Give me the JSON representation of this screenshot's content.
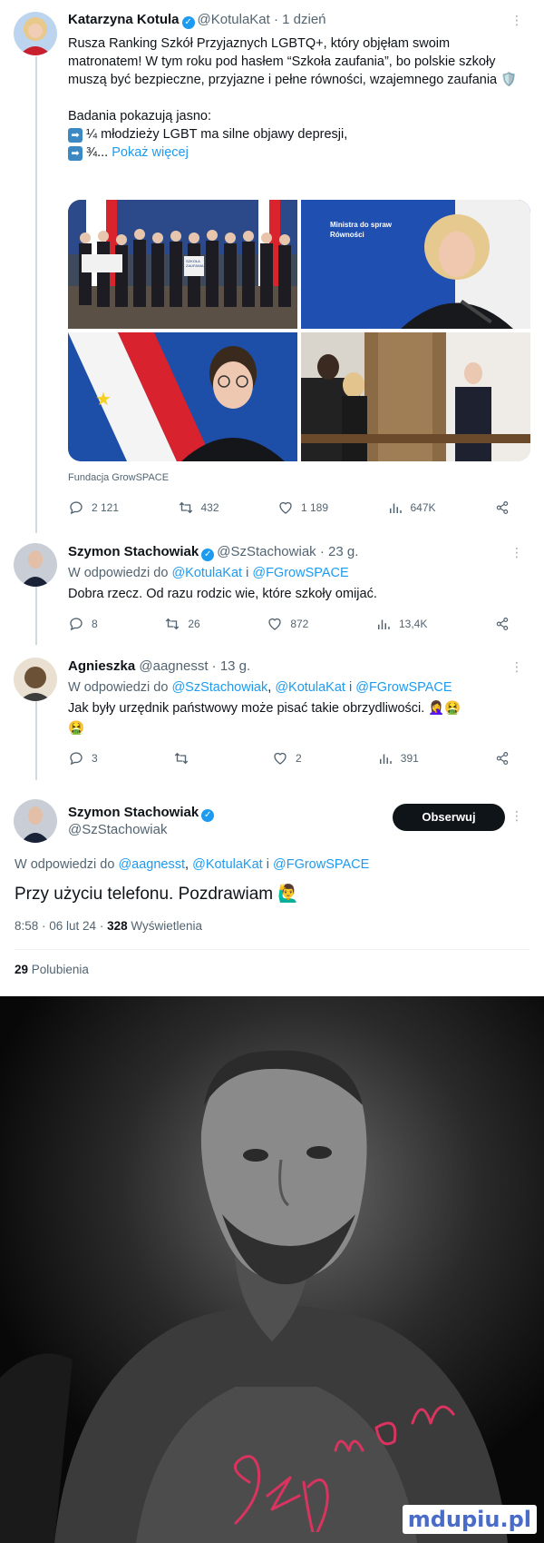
{
  "tweet1": {
    "name": "Katarzyna Kotula",
    "handle": "@KotulaKat",
    "time": "1 dzień",
    "text": "Rusza Ranking Szkół Przyjaznych LGBTQ+, który objęłam swoim matronatem! W tym roku pod hasłem “Szkoła zaufania”, bo polskie szkoły muszą być bezpieczne, przyjazne i pełne równości, wzajemnego zaufania 🛡️",
    "text2": "Badania pokazują jasno:",
    "line3": "¼ młodzieży LGBT ma silne objawy depresji,",
    "line4": "¾...",
    "show_more": "Pokaż więcej",
    "photo_caption": "SZKOŁA ZAUFANIA",
    "photo_banner": "Ministra do spraw Równości",
    "media_credit": "Fundacja GrowSPACE",
    "replies": "2 121",
    "reposts": "432",
    "likes": "1 189",
    "views": "647K"
  },
  "tweet2": {
    "name": "Szymon Stachowiak",
    "handle": "@SzStachowiak",
    "time": "23 g.",
    "reply_prefix": "W odpowiedzi do",
    "reply_to1": "@KotulaKat",
    "reply_and": "i",
    "reply_to2": "@FGrowSPACE",
    "text": "Dobra rzecz. Od razu rodzic wie, które szkoły omijać.",
    "replies": "8",
    "reposts": "26",
    "likes": "872",
    "views": "13,4K"
  },
  "tweet3": {
    "name": "Agnieszka",
    "handle": "@aagnesst",
    "time": "13 g.",
    "reply_prefix": "W odpowiedzi do",
    "reply_to1": "@SzStachowiak",
    "reply_to2": "@KotulaKat",
    "reply_and": "i",
    "reply_to3": "@FGrowSPACE",
    "text": "Jak były urzędnik państwowy może pisać takie obrzydliwości. 🤦‍♀️🤮",
    "text_line2": "🤮",
    "replies": "3",
    "reposts": "",
    "likes": "2",
    "views": "391"
  },
  "main_tweet": {
    "name": "Szymon Stachowiak",
    "handle": "@SzStachowiak",
    "follow_label": "Obserwuj",
    "reply_prefix": "W odpowiedzi do",
    "reply_to1": "@aagnesst",
    "reply_to2": "@KotulaKat",
    "reply_and": "i",
    "reply_to3": "@FGrowSPACE",
    "text": "Przy użyciu telefonu. Pozdrawiam 🙋‍♂️",
    "time": "8:58 · 06 lut 24 ·",
    "views_count": "328",
    "views_label": "Wyświetlenia",
    "likes_count": "29",
    "likes_label": "Polubienia"
  },
  "meme": {
    "signature": "Szymon",
    "watermark": "mdupiu.pl"
  },
  "colors": {
    "link": "#1d9bf0",
    "text": "#0f1419",
    "muted": "#536471",
    "signature": "#d8345f"
  }
}
